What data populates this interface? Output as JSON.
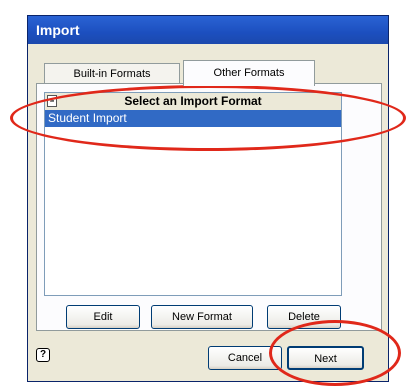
{
  "window": {
    "title": "Import"
  },
  "tabs": [
    {
      "label": "Built-in Formats",
      "active": false
    },
    {
      "label": "Other Formats",
      "active": true
    }
  ],
  "list": {
    "header": "Select an Import Format",
    "items": [
      {
        "label": "Student Import",
        "selected": true
      }
    ]
  },
  "actions": {
    "edit_label": "Edit",
    "new_format_label": "New Format",
    "delete_label": "Delete"
  },
  "footer": {
    "help_symbol": "?",
    "cancel_label": "Cancel",
    "next_label": "Next"
  },
  "colors": {
    "titlebar": "#1c4fbf",
    "selection": "#316ac5",
    "annotation": "#e0281a"
  }
}
